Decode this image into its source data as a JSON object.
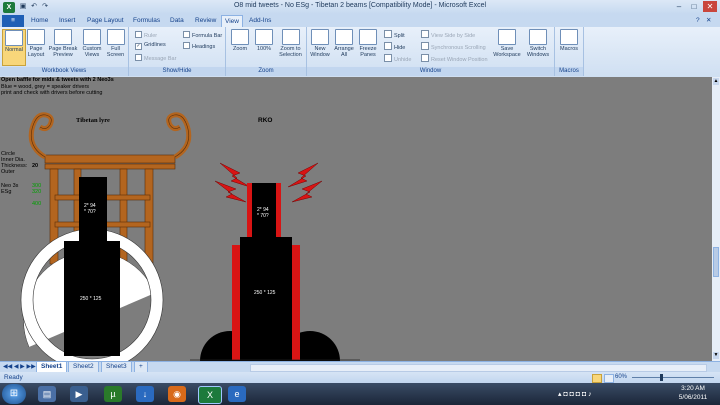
{
  "window": {
    "title": "O8 mid tweets - No ESg - Tibetan 2 beams  [Compatibility Mode] - Microsoft Excel",
    "app_icon": "X"
  },
  "tabs": [
    "Home",
    "Insert",
    "Page Layout",
    "Formulas",
    "Data",
    "Review",
    "View",
    "Add-Ins"
  ],
  "active_tab": "View",
  "ribbon": {
    "workbook_views": {
      "label": "Workbook Views",
      "buttons": [
        "Normal",
        "Page Layout",
        "Page Break Preview",
        "Custom Views",
        "Full Screen"
      ]
    },
    "show_hide": {
      "label": "Show/Hide",
      "items": [
        "Ruler",
        "Gridlines",
        "Message Bar",
        "Formula Bar",
        "Headings"
      ]
    },
    "zoom": {
      "label": "Zoom",
      "buttons": [
        "Zoom",
        "100%",
        "Zoom to Selection"
      ]
    },
    "window": {
      "label": "Window",
      "buttons": [
        "New Window",
        "Arrange All",
        "Freeze Panes"
      ],
      "small": [
        "Split",
        "Hide",
        "Unhide",
        "View Side by Side",
        "Synchronous Scrolling",
        "Reset Window Position"
      ],
      "buttons2": [
        "Save Workspace",
        "Switch Windows"
      ]
    },
    "macros": {
      "label": "Macros",
      "buttons": [
        "Macros"
      ]
    }
  },
  "sheet": {
    "notes": [
      "Open baffle for mids & tweets with 2 Neo3s",
      "Blue = wood, grey = speaker drivers",
      "print and check with drivers before cutting"
    ],
    "circle_labels": [
      "Circle",
      "Inner Dia.",
      "Thickness:",
      "Outer"
    ],
    "thickness_value": "20",
    "neo_labels": [
      "Neo 3s",
      "ESg"
    ],
    "green_values": [
      "300",
      "320",
      "400"
    ],
    "title_left": "Tibetan lyre",
    "title_right": "RKO",
    "driver_small_left": "2* 94\n* 70?",
    "driver_small_right": "2* 94\n* 70?",
    "driver_large_left": "250 * 125",
    "driver_large_right": "250 * 125"
  },
  "sheet_tabs": [
    "Sheet1",
    "Sheet2",
    "Sheet3"
  ],
  "active_sheet": "Sheet1",
  "status": {
    "ready": "Ready",
    "zoom": "60%"
  },
  "taskbar": {
    "time": "3:20 AM",
    "date": "5/06/2011"
  },
  "colors": {
    "wood": "#b3651f",
    "sheet_bg": "#7d7d7d",
    "red": "#d81414",
    "green": "#00a000"
  }
}
